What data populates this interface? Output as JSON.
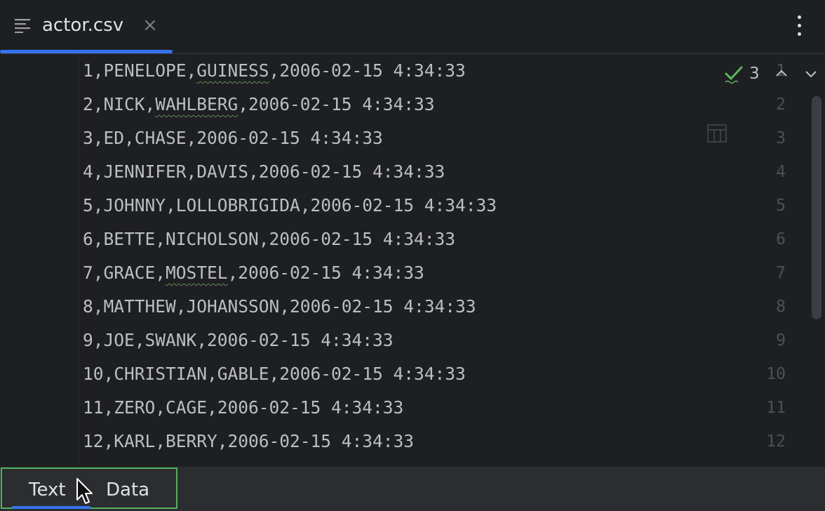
{
  "tab": {
    "title": "actor.csv",
    "close": "×"
  },
  "inspections": {
    "count": "3"
  },
  "lines": [
    {
      "num": "1",
      "text": "1,PENELOPE,GUINESS,2006-02-15 4:34:33"
    },
    {
      "num": "2",
      "text": "2,NICK,WAHLBERG,2006-02-15 4:34:33"
    },
    {
      "num": "3",
      "text": "3,ED,CHASE,2006-02-15 4:34:33"
    },
    {
      "num": "4",
      "text": "4,JENNIFER,DAVIS,2006-02-15 4:34:33"
    },
    {
      "num": "5",
      "text": "5,JOHNNY,LOLLOBRIGIDA,2006-02-15 4:34:33"
    },
    {
      "num": "6",
      "text": "6,BETTE,NICHOLSON,2006-02-15 4:34:33"
    },
    {
      "num": "7",
      "text": "7,GRACE,MOSTEL,2006-02-15 4:34:33"
    },
    {
      "num": "8",
      "text": "8,MATTHEW,JOHANSSON,2006-02-15 4:34:33"
    },
    {
      "num": "9",
      "text": "9,JOE,SWANK,2006-02-15 4:34:33"
    },
    {
      "num": "10",
      "text": "10,CHRISTIAN,GABLE,2006-02-15 4:34:33"
    },
    {
      "num": "11",
      "text": "11,ZERO,CAGE,2006-02-15 4:34:33"
    },
    {
      "num": "12",
      "text": "12,KARL,BERRY,2006-02-15 4:34:33"
    }
  ],
  "typo_words": {
    "1": "GUINESS",
    "2": "WAHLBERG",
    "7": "MOSTEL"
  },
  "view_tabs": {
    "text": "Text",
    "data": "Data"
  },
  "colors": {
    "accent": "#3574f0",
    "focus_border": "#4fb35e",
    "check": "#5fb65f"
  }
}
